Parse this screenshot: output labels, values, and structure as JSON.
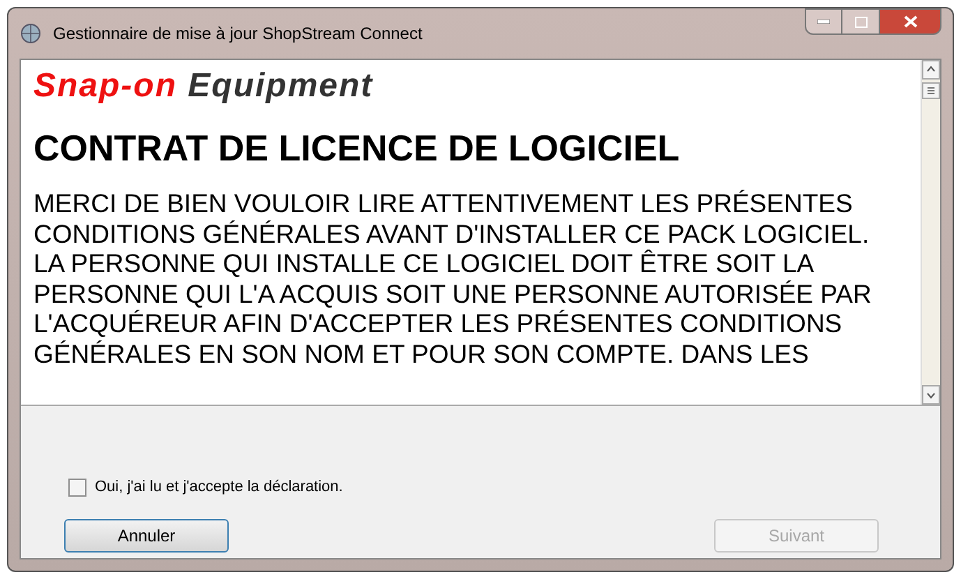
{
  "window": {
    "title": "Gestionnaire de mise à jour ShopStream Connect"
  },
  "logo": {
    "brand": "Snap-on",
    "product": "Equipment"
  },
  "heading": "CONTRAT DE LICENCE DE LOGICIEL",
  "body_lines": [
    "MERCI DE BIEN VOULOIR LIRE ATTENTIVEMENT LES PRÉSENTES",
    "CONDITIONS GÉNÉRALES AVANT D'INSTALLER CE PACK LOGICIEL.",
    "LA PERSONNE QUI INSTALLE CE LOGICIEL DOIT ÊTRE SOIT LA",
    "PERSONNE QUI L'A ACQUIS SOIT UNE PERSONNE AUTORISÉE PAR",
    "L'ACQUÉREUR AFIN D'ACCEPTER LES PRÉSENTES CONDITIONS",
    "GÉNÉRALES EN SON NOM ET POUR SON COMPTE. DANS LES"
  ],
  "accept": {
    "label": "Oui, j'ai lu et j'accepte la déclaration.",
    "checked": false
  },
  "buttons": [
    {
      "label": "Annuler",
      "disabled": false
    },
    {
      "label": "Suivant",
      "disabled": true
    }
  ]
}
